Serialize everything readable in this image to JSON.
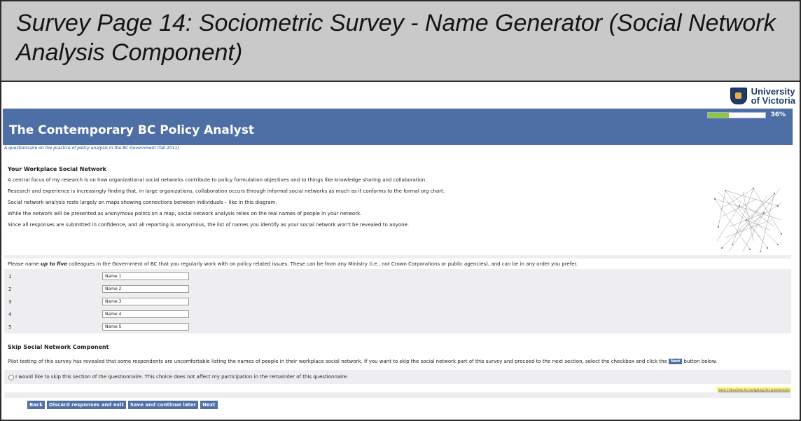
{
  "window": {
    "title": "Survey Page 14: Sociometric Survey - Name Generator (Social Network Analysis Component)"
  },
  "logo": {
    "line1": "University",
    "line2": "of Victoria"
  },
  "banner": {
    "title": "The Contemporary BC Policy Analyst",
    "progress_label": "36%",
    "progress_value": 0.36
  },
  "subtitle": "A questionnaire on the practice of policy analysis in the BC Government (fall 2011)",
  "section": {
    "heading": "Your Workplace Social Network",
    "paragraphs": [
      "A central focus of my research is on how organizational social networks contribute to policy formulation objectives and to things like knowledge sharing and collaboration.",
      "Research and experience is increasingly finding that, in large organizations, collaboration occurs through informal social networks as much as it conforms to the formal org chart.",
      "Social network analysis rests largely on maps showing connections between individuals – like in this diagram.",
      "While the network will be presented as anonymous points on a map, social network analysis relies on the real names of people in your network.",
      "Since all responses are submitted in confidence, and all reporting is anonymous, the list of names you identify as your social network won't be revealed to anyone."
    ]
  },
  "question": {
    "prefix": "Please name ",
    "emphasis": "up to five",
    "suffix": " colleagues in the Government of BC that you regularly work with on policy related issues. These can be from any Ministry (i.e., not Crown Corporations or public agencies), and can be in any order you prefer."
  },
  "names": [
    {
      "num": "1",
      "value": "Name 1"
    },
    {
      "num": "2",
      "value": "Name 2"
    },
    {
      "num": "3",
      "value": "Name 3"
    },
    {
      "num": "4",
      "value": "Name 4"
    },
    {
      "num": "5",
      "value": "Name 5"
    }
  ],
  "skip": {
    "heading": "Skip Social Network Component",
    "text_before": "Pilot testing of this survey has revealed that some respondents are uncomfortable listing the names of people in their workplace social network. If you want to skip the social network part of this survey and proceed to the next section, select the checkbox and click the ",
    "next_chip": "Next",
    "text_after": " button below.",
    "option_label": "I would like to skip this section of the questionnaire. This choice does not affect my participation in the remainder of this questionnaire."
  },
  "instructions_link": "basic instructions for navigating this questionnaire",
  "buttons": {
    "back": "Back",
    "discard": "Discard responses and exit",
    "save": "Save and continue later",
    "next": "Next"
  },
  "colors": {
    "banner": "#4e6ea6",
    "title_bar": "#c9c9c9",
    "panel": "#eeeef0",
    "progress_fill": "#8cc63f"
  }
}
